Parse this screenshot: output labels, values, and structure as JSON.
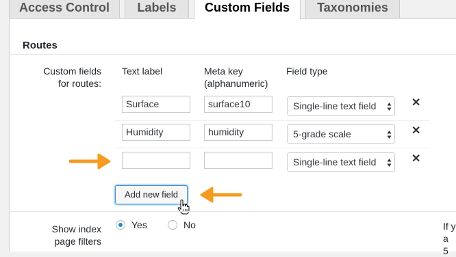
{
  "tabs": [
    {
      "label": "Access Control",
      "active": false
    },
    {
      "label": "Labels",
      "active": false
    },
    {
      "label": "Custom Fields",
      "active": true
    },
    {
      "label": "Taxonomies",
      "active": false
    }
  ],
  "section": {
    "title": "Routes"
  },
  "custom_fields": {
    "row_label_line1": "Custom fields",
    "row_label_line2": "for routes:",
    "headers": {
      "text_label": "Text label",
      "meta_key_line1": "Meta key",
      "meta_key_line2": "(alphanumeric)",
      "field_type": "Field type"
    },
    "rows": [
      {
        "label": "Surface",
        "meta_key": "surface10",
        "field_type": "Single-line text field"
      },
      {
        "label": "Humidity",
        "meta_key": "humidity",
        "field_type": "5-grade scale"
      },
      {
        "label": "",
        "meta_key": "",
        "field_type": "Single-line text field"
      }
    ],
    "remove_glyph": "✕",
    "add_button_label": "Add new field"
  },
  "index_filters": {
    "label_line1": "Show index",
    "label_line2": "page filters",
    "options": [
      {
        "label": "Yes",
        "selected": true
      },
      {
        "label": "No",
        "selected": false
      }
    ],
    "cutoff_text_line1": "If y",
    "cutoff_text_line2": "a 5"
  },
  "colors": {
    "accent": "#1e8cbe",
    "annotation_arrow": "#f39c21"
  },
  "icons": [
    "orange-arrow-right",
    "orange-arrow-left",
    "hand-pointer-cursor",
    "select-updown-arrows",
    "remove-x-icon"
  ]
}
